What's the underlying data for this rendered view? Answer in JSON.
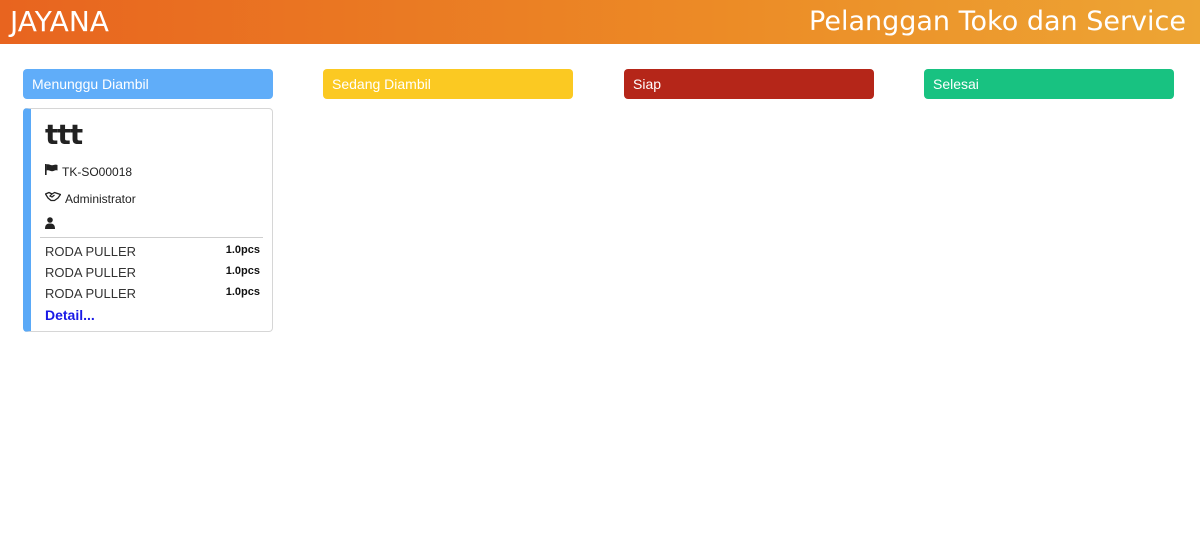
{
  "header": {
    "brand": "JAYANA",
    "title": "Pelanggan Toko dan Service"
  },
  "columns": [
    {
      "label": "Menunggu Diambil",
      "color": "#60adf9"
    },
    {
      "label": "Sedang Diambil",
      "color": "#fbc922"
    },
    {
      "label": "Siap",
      "color": "#b52619"
    },
    {
      "label": "Selesai",
      "color": "#18c281"
    }
  ],
  "card": {
    "title": "ttt",
    "code": "TK-SO00018",
    "handler": "Administrator",
    "customer": "",
    "icons": {
      "code": "flag-icon",
      "handler": "handshake-icon",
      "customer": "user-icon"
    },
    "items": [
      {
        "name": "RODA PULLER",
        "qty": "1.0pcs"
      },
      {
        "name": "RODA PULLER",
        "qty": "1.0pcs"
      },
      {
        "name": "RODA PULLER",
        "qty": "1.0pcs"
      }
    ],
    "detail_label": "Detail..."
  }
}
